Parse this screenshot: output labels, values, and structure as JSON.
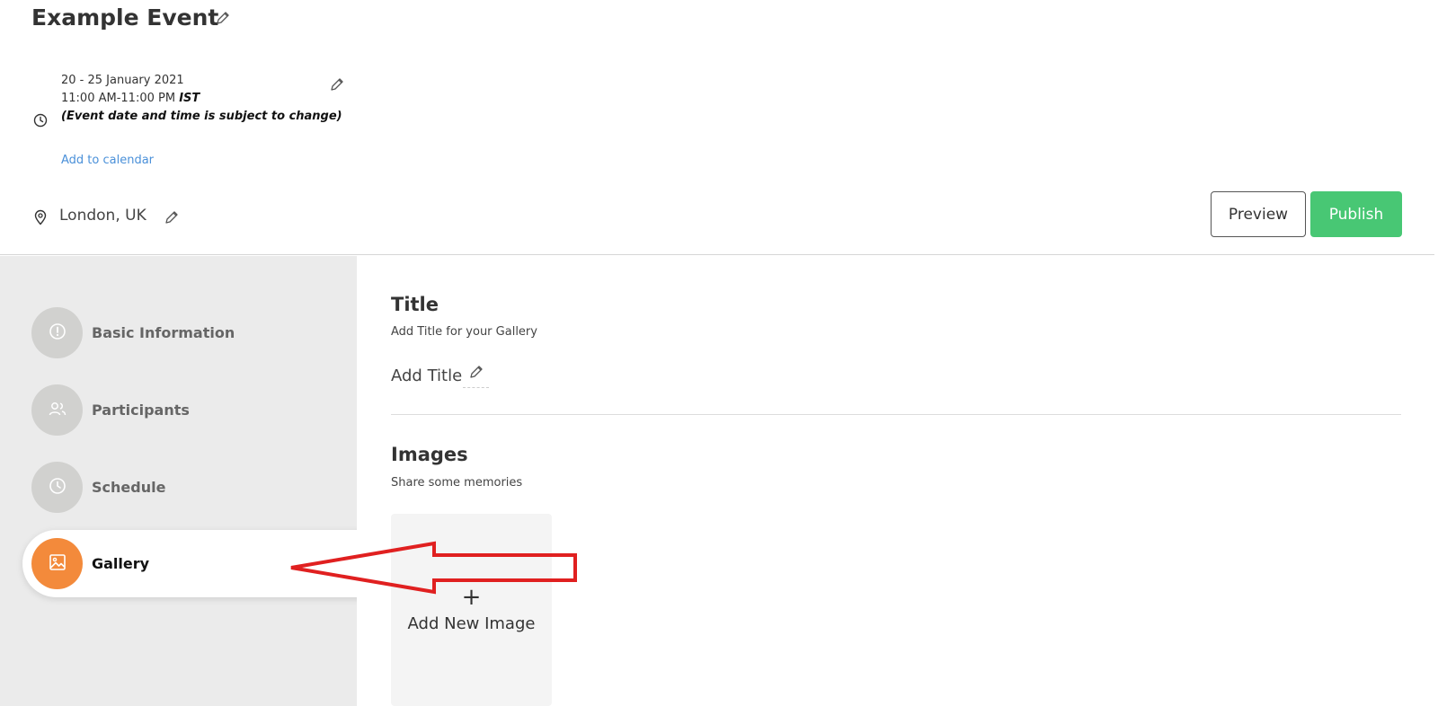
{
  "event": {
    "title": "Example Event",
    "date": "20 - 25 January 2021",
    "time": "11:00 AM-11:00 PM",
    "timezone": "IST",
    "note": "(Event date and time is subject to change)",
    "add_to_calendar": "Add to calendar",
    "location": "London, UK"
  },
  "actions": {
    "preview": "Preview",
    "publish": "Publish"
  },
  "steps": [
    {
      "label": "Basic Information",
      "icon": "info-icon"
    },
    {
      "label": "Participants",
      "icon": "users-icon"
    },
    {
      "label": "Schedule",
      "icon": "clock-icon"
    },
    {
      "label": "Gallery",
      "icon": "image-icon",
      "active": true
    }
  ],
  "gallery": {
    "title_heading": "Title",
    "title_sub": "Add Title for your Gallery",
    "add_title": "Add Title",
    "images_heading": "Images",
    "images_sub": "Share some memories",
    "add_image_plus": "+",
    "add_image_label": "Add New Image"
  },
  "colors": {
    "publish_green": "#48c774",
    "active_orange": "#f38a3b",
    "link_blue": "#4a90d9",
    "annotation_red": "#e02020"
  }
}
